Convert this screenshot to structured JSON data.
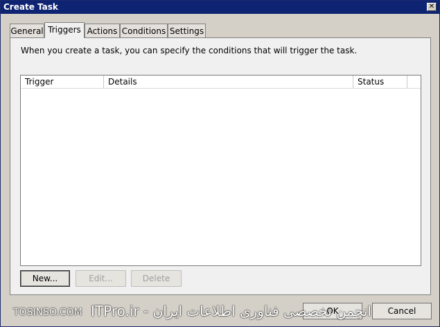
{
  "window": {
    "title": "Create Task",
    "close_glyph": "✕"
  },
  "tabs": [
    {
      "label": "General"
    },
    {
      "label": "Triggers",
      "active": true
    },
    {
      "label": "Actions"
    },
    {
      "label": "Conditions"
    },
    {
      "label": "Settings"
    }
  ],
  "triggers": {
    "description": "When you create a task, you can specify the conditions that will trigger the task.",
    "columns": [
      "Trigger",
      "Details",
      "Status"
    ],
    "rows": [],
    "buttons": {
      "new": "New...",
      "edit": "Edit...",
      "delete": "Delete"
    }
  },
  "footer": {
    "ok": "OK",
    "cancel": "Cancel"
  },
  "watermark": {
    "site": "TOSINSO.COM",
    "text": "ITPro.ir - انجمن تخصصی فناوری اطلاعات ایران"
  }
}
